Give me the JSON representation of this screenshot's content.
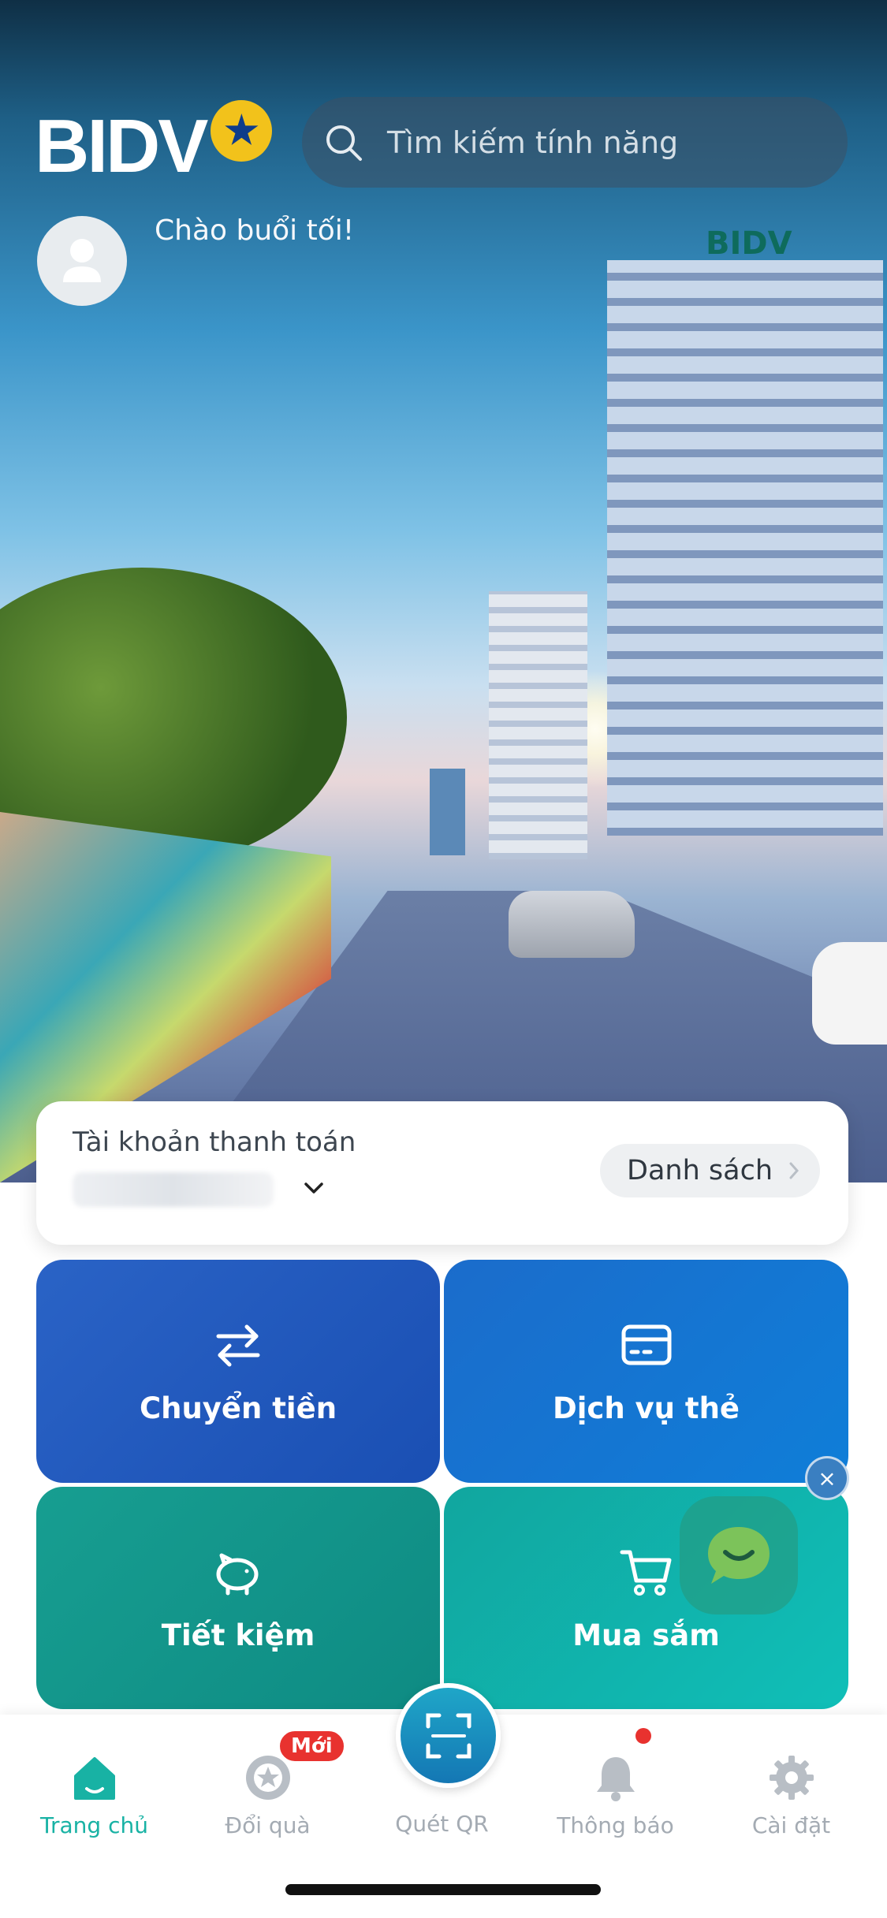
{
  "header": {
    "logo_text": "BIDV",
    "search_placeholder": "Tìm kiếm tính năng",
    "greeting": "Chào buổi tối!"
  },
  "account": {
    "label": "Tài khoản thanh toán",
    "list_button": "Danh sách"
  },
  "tiles": [
    {
      "label": "Chuyển tiền",
      "icon": "transfer-arrows-icon"
    },
    {
      "label": "Dịch vụ thẻ",
      "icon": "card-icon"
    },
    {
      "label": "Tiết kiệm",
      "icon": "piggy-bank-icon"
    },
    {
      "label": "Mua sắm",
      "icon": "shopping-cart-icon"
    }
  ],
  "bottom_nav": {
    "items": [
      {
        "label": "Trang chủ",
        "icon": "home-icon",
        "active": true
      },
      {
        "label": "Đổi quà",
        "icon": "gift-icon",
        "active": false
      },
      {
        "label": "Quét QR",
        "icon": "qr-scan-icon",
        "active": false
      },
      {
        "label": "Thông báo",
        "icon": "bell-icon",
        "active": false
      },
      {
        "label": "Cài đặt",
        "icon": "gear-icon",
        "active": false
      }
    ],
    "new_badge": "Mới"
  },
  "colors": {
    "active_nav": "#18b2a4",
    "inactive_nav": "#a4abb3",
    "badge": "#e8322f",
    "transfer_tile": "#2a63c6",
    "card_tile": "#1b6ccb",
    "save_tile": "#179e91",
    "shop_tile": "#11a69f"
  }
}
